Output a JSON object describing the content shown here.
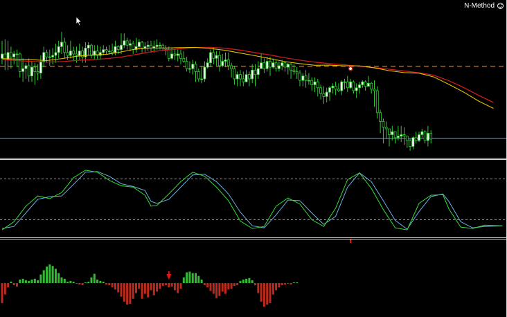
{
  "indicator_label": "N-Method",
  "icons": {
    "status": "smiley-icon",
    "pointer": "mouse-cursor-icon"
  },
  "colors": {
    "background": "#000000",
    "bull_candle": "#ffffff",
    "bear_candle": "#000000",
    "candle_outline": "#33cc33",
    "fast_ma": "#e6c200",
    "slow_ma": "#cc1a1a",
    "level_line": "#e07a18",
    "support_line": "#7f8fa6",
    "stoch_main": "#33dd33",
    "stoch_signal": "#6fb0e0",
    "stoch_levels": "#c8c8c8",
    "hist_positive": "#33bb33",
    "hist_negative": "#bb2a1a",
    "signal_arrow": "#ee1111",
    "separator": "#d8d8d8"
  },
  "price": {
    "ylim": [
      0,
      100
    ],
    "level_value": 58.6,
    "support_value": 9.4,
    "candles": [
      [
        64,
        67,
        76,
        60
      ],
      [
        67,
        63,
        77,
        56
      ],
      [
        63,
        68,
        76,
        56
      ],
      [
        68,
        65,
        72,
        57
      ],
      [
        65,
        67,
        69,
        60
      ],
      [
        67,
        67,
        70,
        58
      ],
      [
        67,
        55,
        68,
        51
      ],
      [
        55,
        57,
        64,
        48
      ],
      [
        57,
        59,
        61,
        50
      ],
      [
        59,
        52,
        64,
        48
      ],
      [
        52,
        58,
        62,
        48
      ],
      [
        58,
        55,
        61,
        46
      ],
      [
        55,
        54,
        60,
        49
      ],
      [
        54,
        62,
        66,
        50
      ],
      [
        62,
        68,
        72,
        58
      ],
      [
        68,
        65,
        70,
        61
      ],
      [
        65,
        65,
        70,
        59
      ],
      [
        65,
        66,
        71,
        60
      ],
      [
        66,
        68,
        74,
        61
      ],
      [
        68,
        72,
        76,
        64
      ],
      [
        72,
        75,
        82,
        67
      ],
      [
        75,
        68,
        78,
        64
      ],
      [
        68,
        66,
        73,
        63
      ],
      [
        66,
        69,
        76,
        64
      ],
      [
        69,
        67,
        72,
        62
      ],
      [
        67,
        66,
        72,
        61
      ],
      [
        66,
        69,
        74,
        63
      ],
      [
        69,
        65,
        72,
        61
      ],
      [
        65,
        71,
        75,
        61
      ],
      [
        71,
        73,
        75,
        66
      ],
      [
        73,
        66,
        74,
        64
      ],
      [
        66,
        69,
        73,
        63
      ],
      [
        69,
        66,
        73,
        63
      ],
      [
        66,
        68,
        72,
        63
      ],
      [
        68,
        70,
        73,
        66
      ],
      [
        70,
        69,
        72,
        67
      ],
      [
        69,
        69,
        73,
        67
      ],
      [
        69,
        68,
        74,
        66
      ],
      [
        68,
        72,
        76,
        66
      ],
      [
        72,
        70,
        73,
        67
      ],
      [
        70,
        73,
        81,
        67
      ],
      [
        73,
        76,
        81,
        71
      ],
      [
        76,
        73,
        78,
        70
      ],
      [
        73,
        74,
        77,
        69
      ],
      [
        74,
        70,
        76,
        67
      ],
      [
        70,
        72,
        78,
        68
      ],
      [
        72,
        75,
        77,
        70
      ],
      [
        75,
        71,
        76,
        68
      ],
      [
        71,
        72,
        75,
        68
      ],
      [
        72,
        73,
        76,
        69
      ],
      [
        73,
        71,
        76,
        68
      ],
      [
        71,
        72,
        76,
        68
      ],
      [
        72,
        73,
        77,
        70
      ],
      [
        73,
        73,
        75,
        70
      ],
      [
        73,
        71,
        74,
        69
      ],
      [
        71,
        70,
        73,
        66
      ],
      [
        70,
        64,
        72,
        62
      ],
      [
        64,
        67,
        71,
        63
      ],
      [
        67,
        66,
        70,
        63
      ],
      [
        66,
        67,
        70,
        62
      ],
      [
        67,
        64,
        70,
        60
      ],
      [
        64,
        62,
        69,
        61
      ],
      [
        62,
        57,
        65,
        55
      ],
      [
        57,
        57,
        62,
        54
      ],
      [
        57,
        60,
        63,
        53
      ],
      [
        60,
        55,
        62,
        48
      ],
      [
        55,
        50,
        57,
        48
      ],
      [
        50,
        50,
        59,
        47
      ],
      [
        50,
        58,
        62,
        48
      ],
      [
        58,
        61,
        64,
        57
      ],
      [
        61,
        68,
        70,
        58
      ],
      [
        68,
        64,
        71,
        60
      ],
      [
        64,
        66,
        69,
        59
      ],
      [
        66,
        59,
        69,
        55
      ],
      [
        59,
        62,
        67,
        58
      ],
      [
        62,
        63,
        68,
        58
      ],
      [
        63,
        59,
        68,
        56
      ],
      [
        59,
        57,
        61,
        51
      ],
      [
        57,
        50,
        59,
        46
      ],
      [
        50,
        53,
        55,
        45
      ],
      [
        53,
        50,
        56,
        45
      ],
      [
        50,
        48,
        55,
        45
      ],
      [
        48,
        53,
        56,
        48
      ],
      [
        53,
        50,
        55,
        45
      ],
      [
        50,
        56,
        60,
        47
      ],
      [
        56,
        53,
        60,
        45
      ],
      [
        53,
        57,
        62,
        50
      ],
      [
        57,
        61,
        67,
        57
      ],
      [
        61,
        57,
        64,
        54
      ],
      [
        57,
        62,
        65,
        55
      ],
      [
        62,
        58,
        65,
        52
      ],
      [
        58,
        61,
        64,
        57
      ],
      [
        61,
        57,
        63,
        55
      ],
      [
        57,
        59,
        62,
        55
      ],
      [
        59,
        61,
        63,
        56
      ],
      [
        61,
        58,
        62,
        55
      ],
      [
        58,
        60,
        61,
        53
      ],
      [
        60,
        56,
        61,
        50
      ],
      [
        56,
        55,
        60,
        53
      ],
      [
        55,
        54,
        58,
        50
      ],
      [
        54,
        49,
        56,
        45
      ],
      [
        49,
        52,
        54,
        45
      ],
      [
        52,
        49,
        56,
        44
      ],
      [
        49,
        49,
        54,
        46
      ],
      [
        49,
        46,
        51,
        42
      ],
      [
        46,
        48,
        51,
        41
      ],
      [
        48,
        44,
        50,
        38
      ],
      [
        44,
        40,
        46,
        36
      ],
      [
        40,
        38,
        45,
        33
      ],
      [
        38,
        41,
        44,
        34
      ],
      [
        41,
        44,
        45,
        35
      ],
      [
        44,
        45,
        47,
        40
      ],
      [
        45,
        43,
        48,
        39
      ],
      [
        43,
        42,
        47,
        41
      ],
      [
        42,
        48,
        49,
        39
      ],
      [
        48,
        48,
        50,
        43
      ],
      [
        48,
        44,
        52,
        41
      ],
      [
        44,
        48,
        50,
        43
      ],
      [
        48,
        42,
        49,
        40
      ],
      [
        42,
        44,
        47,
        37
      ],
      [
        44,
        46,
        48,
        40
      ],
      [
        46,
        48,
        49,
        44
      ],
      [
        48,
        45,
        49,
        42
      ],
      [
        45,
        47,
        52,
        46
      ],
      [
        47,
        43,
        48,
        40
      ],
      [
        43,
        42,
        49,
        31
      ],
      [
        42,
        27,
        45,
        23
      ],
      [
        27,
        21,
        29,
        13
      ],
      [
        21,
        17,
        23,
        6
      ],
      [
        17,
        16,
        21,
        9
      ],
      [
        16,
        12,
        16,
        4
      ],
      [
        12,
        14,
        18,
        8
      ],
      [
        14,
        10,
        14,
        6
      ],
      [
        10,
        11,
        18,
        8
      ],
      [
        11,
        12,
        18,
        7
      ],
      [
        12,
        11,
        17,
        5
      ],
      [
        11,
        8,
        11,
        3
      ],
      [
        8,
        4,
        9,
        1
      ],
      [
        4,
        10,
        11,
        2
      ],
      [
        10,
        8,
        14,
        6
      ],
      [
        8,
        12,
        14,
        7
      ],
      [
        12,
        14,
        16,
        10
      ],
      [
        14,
        8,
        15,
        6
      ],
      [
        8,
        13,
        18,
        4
      ],
      [
        13,
        9,
        15,
        6
      ]
    ],
    "fast_ma": [
      [
        0,
        63.8
      ],
      [
        5,
        63.5
      ],
      [
        10,
        63.1
      ],
      [
        15,
        62.5
      ],
      [
        20,
        63.8
      ],
      [
        25,
        65.4
      ],
      [
        30,
        66.3
      ],
      [
        35,
        66.7
      ],
      [
        40,
        68.4
      ],
      [
        45,
        70.4
      ],
      [
        50,
        71.1
      ],
      [
        55,
        71.1
      ],
      [
        60,
        71.3
      ],
      [
        65,
        71.5
      ],
      [
        70,
        70.7
      ],
      [
        75,
        69.5
      ],
      [
        80,
        67.6
      ],
      [
        85,
        65.8
      ],
      [
        90,
        63.8
      ],
      [
        95,
        61.8
      ],
      [
        100,
        60.4
      ],
      [
        105,
        59.3
      ],
      [
        110,
        59.4
      ],
      [
        115,
        58.9
      ],
      [
        120,
        58.9
      ],
      [
        125,
        57.5
      ],
      [
        130,
        55.6
      ],
      [
        135,
        54.3
      ],
      [
        140,
        53.9
      ],
      [
        145,
        51.3
      ],
      [
        150,
        46.3
      ],
      [
        155,
        41.0
      ],
      [
        160,
        34.9
      ],
      [
        165,
        29.9
      ]
    ],
    "slow_ma": [
      [
        0,
        63.3
      ],
      [
        5,
        62.5
      ],
      [
        10,
        61.9
      ],
      [
        15,
        61.5
      ],
      [
        20,
        61.7
      ],
      [
        25,
        62.6
      ],
      [
        30,
        63.1
      ],
      [
        35,
        63.8
      ],
      [
        40,
        64.9
      ],
      [
        45,
        66.6
      ],
      [
        50,
        68.5
      ],
      [
        55,
        69.6
      ],
      [
        60,
        70.6
      ],
      [
        65,
        71.4
      ],
      [
        70,
        71.5
      ],
      [
        75,
        70.9
      ],
      [
        80,
        69.6
      ],
      [
        85,
        67.9
      ],
      [
        90,
        66.3
      ],
      [
        95,
        64.4
      ],
      [
        100,
        62.8
      ],
      [
        105,
        61.4
      ],
      [
        110,
        60.4
      ],
      [
        115,
        59.6
      ],
      [
        120,
        58.6
      ],
      [
        125,
        57.8
      ],
      [
        130,
        56.6
      ],
      [
        135,
        55.4
      ],
      [
        140,
        54.2
      ],
      [
        145,
        52.5
      ],
      [
        150,
        48.8
      ],
      [
        155,
        44.1
      ],
      [
        160,
        38.8
      ],
      [
        165,
        33.9
      ]
    ],
    "signal_dot": [
      117,
      57
    ]
  },
  "stochastic": {
    "ylim": [
      0,
      100
    ],
    "levels": [
      80,
      20
    ],
    "main": [
      [
        0,
        5
      ],
      [
        4,
        17
      ],
      [
        8,
        40
      ],
      [
        12,
        55
      ],
      [
        16,
        51
      ],
      [
        20,
        60
      ],
      [
        24,
        82
      ],
      [
        28,
        93
      ],
      [
        32,
        90
      ],
      [
        36,
        78
      ],
      [
        40,
        70
      ],
      [
        44,
        68
      ],
      [
        48,
        56
      ],
      [
        50,
        40
      ],
      [
        52,
        41
      ],
      [
        56,
        58
      ],
      [
        60,
        76
      ],
      [
        64,
        90
      ],
      [
        68,
        84
      ],
      [
        72,
        68
      ],
      [
        76,
        48
      ],
      [
        80,
        18
      ],
      [
        84,
        7
      ],
      [
        88,
        10
      ],
      [
        92,
        40
      ],
      [
        96,
        52
      ],
      [
        100,
        43
      ],
      [
        104,
        20
      ],
      [
        108,
        10
      ],
      [
        112,
        37
      ],
      [
        116,
        79
      ],
      [
        120,
        89
      ],
      [
        124,
        66
      ],
      [
        128,
        35
      ],
      [
        132,
        8
      ],
      [
        136,
        5
      ],
      [
        140,
        44
      ],
      [
        144,
        56
      ],
      [
        148,
        57
      ],
      [
        150,
        36
      ],
      [
        154,
        9
      ],
      [
        158,
        7
      ],
      [
        162,
        12
      ],
      [
        168,
        11
      ]
    ],
    "signal": [
      [
        0,
        7
      ],
      [
        4,
        10
      ],
      [
        8,
        30
      ],
      [
        12,
        50
      ],
      [
        16,
        54
      ],
      [
        20,
        55
      ],
      [
        24,
        72
      ],
      [
        28,
        90
      ],
      [
        32,
        91
      ],
      [
        36,
        84
      ],
      [
        40,
        73
      ],
      [
        44,
        69
      ],
      [
        48,
        63
      ],
      [
        50,
        47
      ],
      [
        52,
        44
      ],
      [
        56,
        50
      ],
      [
        60,
        68
      ],
      [
        64,
        86
      ],
      [
        68,
        87
      ],
      [
        72,
        76
      ],
      [
        76,
        58
      ],
      [
        80,
        31
      ],
      [
        84,
        11
      ],
      [
        88,
        8
      ],
      [
        92,
        27
      ],
      [
        96,
        49
      ],
      [
        100,
        48
      ],
      [
        104,
        30
      ],
      [
        108,
        13
      ],
      [
        112,
        25
      ],
      [
        116,
        68
      ],
      [
        120,
        89
      ],
      [
        124,
        76
      ],
      [
        128,
        48
      ],
      [
        132,
        19
      ],
      [
        136,
        6
      ],
      [
        140,
        32
      ],
      [
        144,
        54
      ],
      [
        148,
        58
      ],
      [
        150,
        47
      ],
      [
        154,
        17
      ],
      [
        158,
        8
      ],
      [
        162,
        10
      ],
      [
        168,
        11
      ]
    ]
  },
  "histogram": {
    "ylim": [
      -30,
      30
    ],
    "values": [
      -28,
      -16,
      -6,
      2,
      -3,
      -5,
      5,
      6,
      4,
      3,
      5,
      6,
      4,
      12,
      18,
      23,
      26,
      24,
      20,
      14,
      8,
      6,
      2,
      3,
      2,
      -1,
      -2,
      -3,
      0,
      2,
      8,
      13,
      5,
      3,
      2,
      -2,
      -3,
      -6,
      -9,
      -13,
      -19,
      -26,
      -30,
      -29,
      -22,
      -14,
      -8,
      -22,
      -15,
      -20,
      -10,
      -17,
      -12,
      -8,
      -4,
      -3,
      -6,
      -5,
      -10,
      -14,
      -8,
      8,
      15,
      16,
      14,
      14,
      10,
      5,
      -3,
      -6,
      -11,
      -15,
      -21,
      -18,
      -12,
      -15,
      -9,
      -8,
      -4,
      -3,
      3,
      5,
      6,
      7,
      4,
      -3,
      -14,
      -26,
      -33,
      -30,
      -28,
      -16,
      -10,
      -6,
      -3,
      -2,
      -1,
      -2,
      0,
      0
    ],
    "arrows": [
      56,
      117
    ]
  }
}
